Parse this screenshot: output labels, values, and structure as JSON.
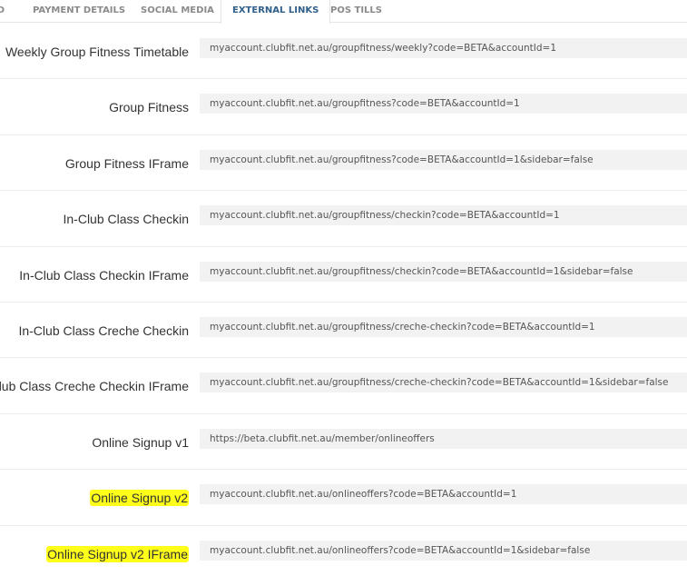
{
  "tabs": [
    {
      "label": "ID"
    },
    {
      "label": "PAYMENT DETAILS"
    },
    {
      "label": "SOCIAL MEDIA"
    },
    {
      "label": "EXTERNAL LINKS",
      "active": true
    },
    {
      "label": "POS TILLS"
    }
  ],
  "links": [
    {
      "label": "Weekly Group Fitness Timetable",
      "url": "myaccount.clubfit.net.au/groupfitness/weekly?code=BETA&accountId=1"
    },
    {
      "label": "Group Fitness",
      "url": "myaccount.clubfit.net.au/groupfitness?code=BETA&accountId=1"
    },
    {
      "label": "Group Fitness IFrame",
      "url": "myaccount.clubfit.net.au/groupfitness?code=BETA&accountId=1&sidebar=false"
    },
    {
      "label": "In-Club Class Checkin",
      "url": "myaccount.clubfit.net.au/groupfitness/checkin?code=BETA&accountId=1"
    },
    {
      "label": "In-Club Class Checkin IFrame",
      "url": "myaccount.clubfit.net.au/groupfitness/checkin?code=BETA&accountId=1&sidebar=false"
    },
    {
      "label": "In-Club Class Creche Checkin",
      "url": "myaccount.clubfit.net.au/groupfitness/creche-checkin?code=BETA&accountId=1"
    },
    {
      "label": "In-Club Class Creche Checkin IFrame",
      "url": "myaccount.clubfit.net.au/groupfitness/creche-checkin?code=BETA&accountId=1&sidebar=false"
    },
    {
      "label": "Online Signup v1",
      "url": "https://beta.clubfit.net.au/member/onlineoffers"
    },
    {
      "label": "Online Signup v2",
      "url": "myaccount.clubfit.net.au/onlineoffers?code=BETA&accountId=1",
      "highlighted": true
    },
    {
      "label": "Online Signup v2 IFrame",
      "url": "myaccount.clubfit.net.au/onlineoffers?code=BETA&accountId=1&sidebar=false",
      "highlighted": true
    }
  ],
  "colors": {
    "active_tab": "#2f5f8a",
    "inactive_tab": "#8a8a8a",
    "highlight": "#ffff1a",
    "url_background": "#f2f2f2"
  }
}
